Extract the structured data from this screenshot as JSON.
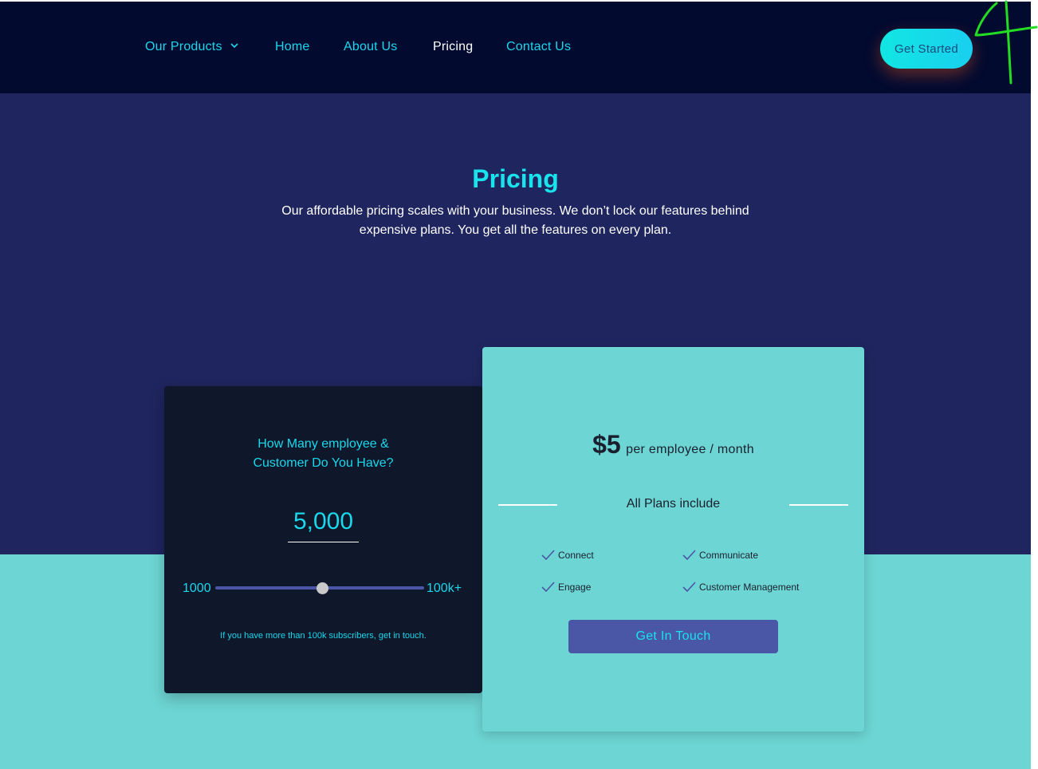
{
  "nav": {
    "items": [
      {
        "label": "Our Products",
        "has_dropdown": true
      },
      {
        "label": "Home"
      },
      {
        "label": "About Us"
      },
      {
        "label": "Pricing",
        "active": true
      },
      {
        "label": "Contact Us"
      }
    ],
    "cta_label": "Get Started"
  },
  "hero": {
    "title": "Pricing",
    "description": "Our affordable pricing scales with your business. We don’t lock our features behind expensive plans. You get all the features on every plan."
  },
  "calculator": {
    "question_line1": "How Many employee &",
    "question_line2": "Customer Do You Have?",
    "value": "5,000",
    "range_min": "1000",
    "range_max": "100k+",
    "slider_level": 0.5,
    "note": "If you have more than 100k subscribers, get in touch."
  },
  "plan": {
    "price": "$5",
    "price_unit": "per employee / month",
    "includes_label": "All Plans include",
    "features": [
      "Connect",
      "Communicate",
      "Engage",
      "Customer Management"
    ],
    "button_label": "Get In Touch"
  },
  "colors": {
    "header_bg": "#020a30",
    "hero_bg": "#1f255e",
    "accent_cyan": "#19d8ec",
    "teal": "#6dd5d3",
    "dark_card": "#0f172a",
    "button_purple": "#4a56a6"
  },
  "icons": {
    "dropdown": "chevron-down-icon",
    "feature_check": "check-icon",
    "annotation": "scribble-annotation"
  }
}
